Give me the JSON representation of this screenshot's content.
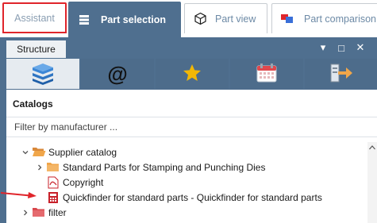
{
  "tabs": [
    {
      "label": "Assistant",
      "icon": "none"
    },
    {
      "label": "Part selection",
      "icon": "stack-icon"
    },
    {
      "label": "Part view",
      "icon": "cube-icon"
    },
    {
      "label": "Part comparison",
      "icon": "compare-icon"
    }
  ],
  "panel": {
    "title": "Structure",
    "controls": {
      "dropdown": "▾",
      "maximize": "□",
      "close": "✕"
    }
  },
  "toolbar": {
    "buttons": [
      {
        "name": "catalogs-icon",
        "active": true
      },
      {
        "name": "at-sign-icon",
        "glyph": "@",
        "active": false
      },
      {
        "name": "star-icon",
        "active": false
      },
      {
        "name": "calendar-icon",
        "active": false
      },
      {
        "name": "export-icon",
        "active": false
      }
    ]
  },
  "catalogs": {
    "title": "Catalogs",
    "filter_placeholder": "Filter by manufacturer ..."
  },
  "tree": {
    "items": [
      {
        "label": "Supplier catalog",
        "chevron": "⌄",
        "icon": "folder-open-icon"
      },
      {
        "label": "Standard Parts for Stamping and Punching Dies",
        "chevron": "›",
        "icon": "folder-icon"
      },
      {
        "label": "Copyright",
        "chevron": "",
        "icon": "pdf-icon"
      },
      {
        "label": "Quickfinder for standard parts - Quickfinder for standard parts",
        "chevron": "",
        "icon": "calculator-icon"
      },
      {
        "label": "filter",
        "chevron": "›",
        "icon": "folder-red-icon"
      }
    ]
  },
  "colors": {
    "panel_blue": "#4f6f8f",
    "highlight_red": "#e0252b",
    "star_yellow": "#f2b705",
    "folder_orange": "#f0a64a"
  }
}
